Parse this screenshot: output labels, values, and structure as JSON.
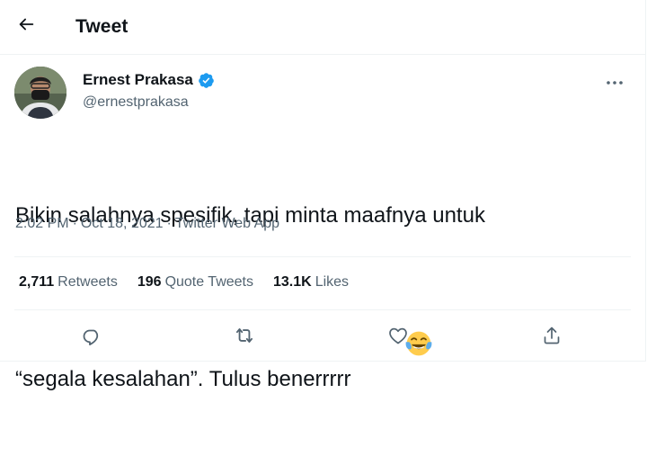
{
  "header": {
    "title": "Tweet",
    "back_icon": "arrow-left-icon"
  },
  "author": {
    "name": "Ernest Prakasa",
    "handle": "@ernestprakasa",
    "verified_icon": "verified-badge-icon",
    "verified_color": "#1d9bf0"
  },
  "tweet": {
    "line1": "Bikin salahnya spesifik, tapi minta maafnya untuk",
    "line2": "“segala kesalahan”. Tulus benerrrrr",
    "emoji": "face-with-tears-of-joy-icon"
  },
  "meta": {
    "time": "2:02 PM",
    "date": "Oct 18, 2021",
    "source": "Twitter Web App",
    "separator": "·"
  },
  "stats": [
    {
      "count": "2,711",
      "label": "Retweets"
    },
    {
      "count": "196",
      "label": "Quote Tweets"
    },
    {
      "count": "13.1K",
      "label": "Likes"
    }
  ],
  "actions": [
    "reply-icon",
    "retweet-icon",
    "like-icon",
    "share-icon"
  ],
  "colors": {
    "text": "#0f1419",
    "secondary": "#536471",
    "divider": "#eff3f4"
  }
}
